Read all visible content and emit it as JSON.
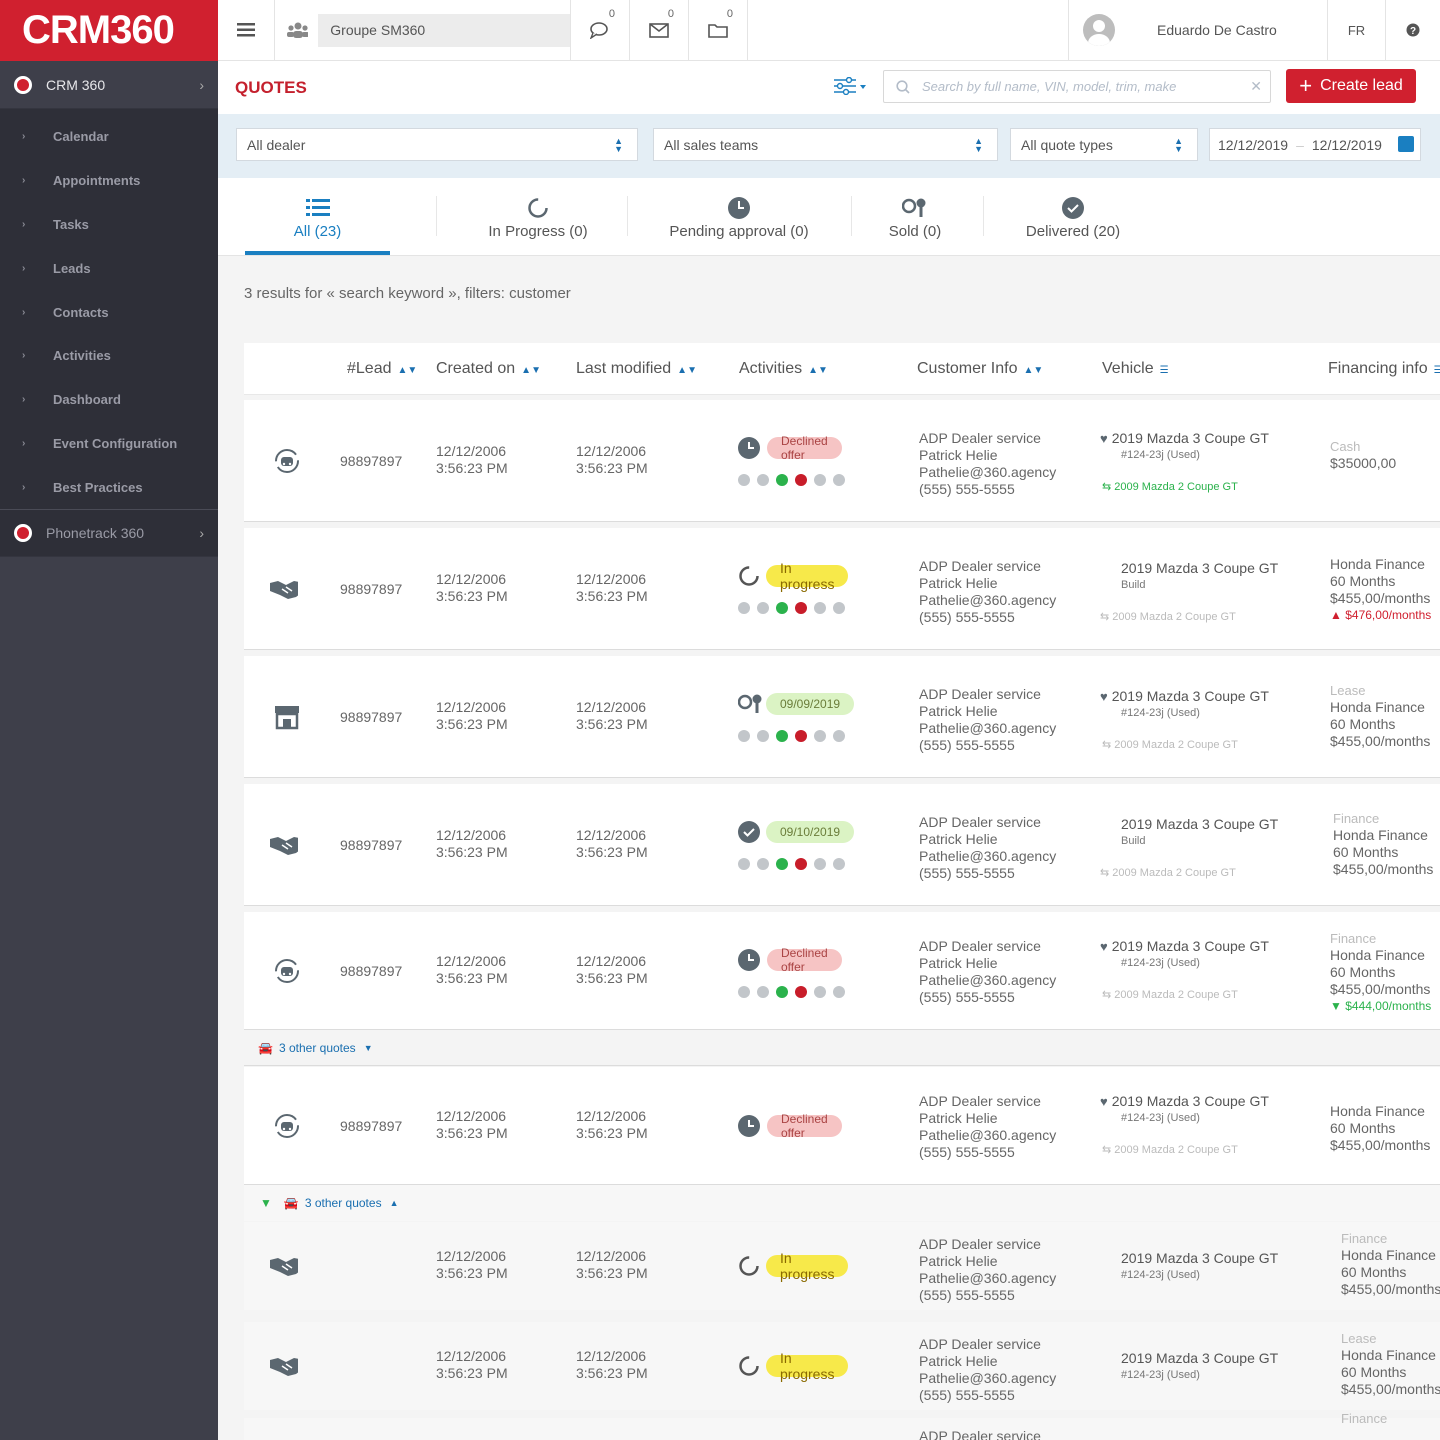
{
  "brand": {
    "name": "CRM360",
    "color": "#d0202f"
  },
  "sidebar": {
    "app": "CRM 360",
    "items": [
      "Calendar",
      "Appointments",
      "Tasks",
      "Leads",
      "Contacts",
      "Activities",
      "Dashboard",
      "Event Configuration",
      "Best Practices"
    ],
    "app2": "Phonetrack 360"
  },
  "topbar": {
    "group": "Groupe SM360",
    "badges": {
      "chat": "0",
      "mail": "0",
      "folder": "0"
    },
    "user": "Eduardo De Castro",
    "lang": "FR",
    "help_icon": "question-icon"
  },
  "header": {
    "title": "QUOTES",
    "search_placeholder": "Search by full name, VIN, model, trim, make",
    "create_label": "Create lead"
  },
  "filters": {
    "dealer": "All dealer",
    "teams": "All sales teams",
    "types": "All quote types",
    "date_from": "12/12/2019",
    "date_to": "12/12/2019"
  },
  "tabs": [
    {
      "label": "All (23)",
      "icon": "list-icon"
    },
    {
      "label": "In Progress (0)",
      "icon": "progress-icon"
    },
    {
      "label": "Pending approval (0)",
      "icon": "clock-icon"
    },
    {
      "label": "Sold (0)",
      "icon": "keys-icon"
    },
    {
      "label": "Delivered (20)",
      "icon": "check-icon"
    }
  ],
  "results_text": "3 results for « search keyword », filters: customer",
  "columns": [
    "#Lead",
    "Created on",
    "Last modified",
    "Activities",
    "Customer Info",
    "Vehicle",
    "Financing info"
  ],
  "colors": {
    "accent": "#1a7fc1",
    "danger": "#d0202f",
    "success": "#2bb24c"
  },
  "rows": [
    {
      "lead": "98897897",
      "created": "12/12/2006",
      "created_time": "3:56:23 PM",
      "modified": "12/12/2006",
      "modified_time": "3:56:23 PM",
      "status": "Declined offer",
      "cust": [
        "ADP Dealer service",
        "Patrick Helie",
        "Pathelie@360.agency",
        "(555) 555-5555"
      ],
      "veh": "2019 Mazda 3 Coupe GT",
      "veh2": "#124-23j (Used)",
      "veh3": "2009 Mazda 2 Coupe GT",
      "fin_label": "Cash",
      "fin1": "$35000,00",
      "fin2": "",
      "fin3": "",
      "fin_extra": ""
    },
    {
      "lead": "98897897",
      "created": "12/12/2006",
      "created_time": "3:56:23 PM",
      "modified": "12/12/2006",
      "modified_time": "3:56:23 PM",
      "status": "In progress",
      "cust": [
        "ADP Dealer service",
        "Patrick Helie",
        "Pathelie@360.agency",
        "(555) 555-5555"
      ],
      "veh": "2019 Mazda 3 Coupe GT",
      "veh2": "Build",
      "veh3": "2009 Mazda 2 Coupe GT",
      "fin_label": "",
      "fin1": "Honda Finance",
      "fin2": "60 Months",
      "fin3": "$455,00/months",
      "fin_extra": "$476,00/months"
    },
    {
      "lead": "98897897",
      "created": "12/12/2006",
      "created_time": "3:56:23 PM",
      "modified": "12/12/2006",
      "modified_time": "3:56:23 PM",
      "status": "09/09/2019",
      "cust": [
        "ADP Dealer service",
        "Patrick Helie",
        "Pathelie@360.agency",
        "(555) 555-5555"
      ],
      "veh": "2019 Mazda 3 Coupe GT",
      "veh2": "#124-23j (Used)",
      "veh3": "2009 Mazda 2 Coupe GT",
      "fin_label": "Lease",
      "fin1": "Honda Finance",
      "fin2": "60 Months",
      "fin3": "$455,00/months",
      "fin_extra": ""
    },
    {
      "lead": "98897897",
      "created": "12/12/2006",
      "created_time": "3:56:23 PM",
      "modified": "12/12/2006",
      "modified_time": "3:56:23 PM",
      "status": "09/10/2019",
      "cust": [
        "ADP Dealer service",
        "Patrick Helie",
        "Pathelie@360.agency",
        "(555) 555-5555"
      ],
      "veh": "2019 Mazda 3 Coupe GT",
      "veh2": "Build",
      "veh3": "2009 Mazda 2 Coupe GT",
      "fin_label": "Finance",
      "fin1": "Honda Finance",
      "fin2": "60 Months",
      "fin3": "$455,00/months",
      "fin_extra": ""
    },
    {
      "lead": "98897897",
      "created": "12/12/2006",
      "created_time": "3:56:23 PM",
      "modified": "12/12/2006",
      "modified_time": "3:56:23 PM",
      "status": "Declined offer",
      "cust": [
        "ADP Dealer service",
        "Patrick Helie",
        "Pathelie@360.agency",
        "(555) 555-5555"
      ],
      "veh": "2019 Mazda 3 Coupe GT",
      "veh2": "#124-23j (Used)",
      "veh3": "2009 Mazda 2 Coupe GT",
      "fin_label": "Finance",
      "fin1": "Honda Finance",
      "fin2": "60 Months",
      "fin3": "$455,00/months",
      "fin_extra": "$444,00/months"
    },
    {
      "lead": "98897897",
      "created": "12/12/2006",
      "created_time": "3:56:23 PM",
      "modified": "12/12/2006",
      "modified_time": "3:56:23 PM",
      "status": "Declined offer",
      "cust": [
        "ADP Dealer service",
        "Patrick Helie",
        "Pathelie@360.agency",
        "(555) 555-5555"
      ],
      "veh": "2019 Mazda 3 Coupe GT",
      "veh2": "#124-23j (Used)",
      "veh3": "2009 Mazda 2 Coupe GT",
      "fin_label": "",
      "fin1": "Honda Finance",
      "fin2": "60 Months",
      "fin3": "$455,00/months",
      "fin_extra": ""
    },
    {
      "lead": "",
      "created": "12/12/2006",
      "created_time": "3:56:23 PM",
      "modified": "12/12/2006",
      "modified_time": "3:56:23 PM",
      "status": "In progress",
      "cust": [
        "ADP Dealer service",
        "Patrick Helie",
        "Pathelie@360.agency",
        "(555) 555-5555"
      ],
      "veh": "2019 Mazda 3 Coupe GT",
      "veh2": "#124-23j (Used)",
      "veh3": "",
      "fin_label": "Finance",
      "fin1": "Honda Finance",
      "fin2": "60 Months",
      "fin3": "$455,00/months",
      "fin_extra": ""
    },
    {
      "lead": "",
      "created": "12/12/2006",
      "created_time": "3:56:23 PM",
      "modified": "12/12/2006",
      "modified_time": "3:56:23 PM",
      "status": "In progress",
      "cust": [
        "ADP Dealer service",
        "Patrick Helie",
        "Pathelie@360.agency",
        "(555) 555-5555"
      ],
      "veh": "2019 Mazda 3 Coupe GT",
      "veh2": "#124-23j (Used)",
      "veh3": "",
      "fin_label": "Lease",
      "fin1": "Honda Finance",
      "fin2": "60 Months",
      "fin3": "$455,00/months",
      "fin_extra": ""
    },
    {
      "cust0": "ADP Dealer service",
      "fin_label": "Finance"
    }
  ],
  "groups": [
    "3 other quotes",
    "3 other quotes"
  ]
}
